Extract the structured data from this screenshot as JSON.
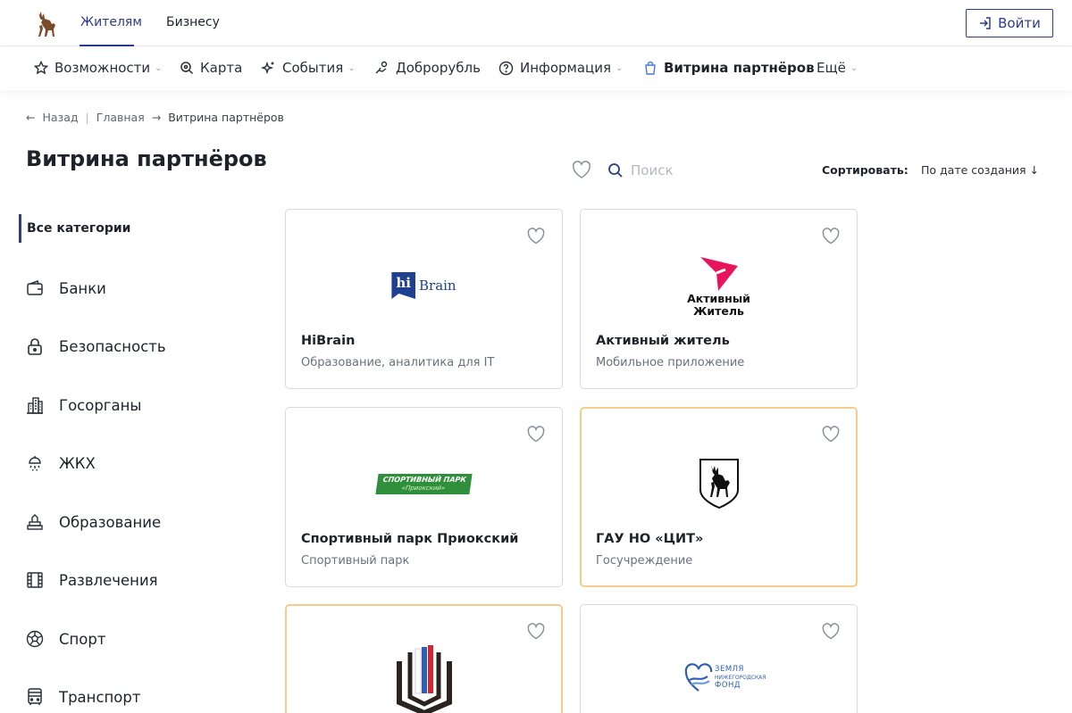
{
  "header": {
    "tabs": [
      {
        "label": "Жителям"
      },
      {
        "label": "Бизнесу"
      }
    ],
    "login_label": "Войти"
  },
  "nav": {
    "items": [
      {
        "label": "Возможности",
        "icon": "star-icon"
      },
      {
        "label": "Карта",
        "icon": "map-search-icon"
      },
      {
        "label": "События",
        "icon": "sparkle-icon"
      },
      {
        "label": "Доброрубль",
        "icon": "hand-coin-icon"
      },
      {
        "label": "Информация",
        "icon": "question-circle-icon"
      },
      {
        "label": "Витрина партнёров",
        "icon": "shopping-bag-icon"
      },
      {
        "label": "Ещё"
      }
    ]
  },
  "breadcrumb": {
    "back": "Назад",
    "home": "Главная",
    "current": "Витрина партнёров"
  },
  "page": {
    "title": "Витрина партнёров",
    "search_placeholder": "Поиск",
    "sort_label": "Сортировать:",
    "sort_value": "По дате создания"
  },
  "sidebar": {
    "all_label": "Все категории",
    "categories": [
      {
        "label": "Банки",
        "icon": "wallet-icon"
      },
      {
        "label": "Безопасность",
        "icon": "lock-icon"
      },
      {
        "label": "Госорганы",
        "icon": "building-icon"
      },
      {
        "label": "ЖКХ",
        "icon": "shower-icon"
      },
      {
        "label": "Образование",
        "icon": "books-icon"
      },
      {
        "label": "Развлечения",
        "icon": "film-icon"
      },
      {
        "label": "Спорт",
        "icon": "ball-icon"
      },
      {
        "label": "Транспорт",
        "icon": "bus-icon"
      }
    ]
  },
  "cards": [
    {
      "title": "HiBrain",
      "subtitle": "Образование, аналитика для IT",
      "logo_text": [
        "hi",
        "Brain"
      ]
    },
    {
      "title": "Активный житель",
      "subtitle": "Мобильное приложение",
      "logo_text": [
        "Активный",
        "Житель"
      ]
    },
    {
      "title": "Спортивный парк Приокский",
      "subtitle": "Спортивный парк",
      "logo_text": [
        "СПОРТИВНЫЙ ПАРК",
        "«Приокский»"
      ]
    },
    {
      "title": "ГАУ НО «ЦИТ»",
      "subtitle": "Госучреждение"
    },
    {
      "title": "",
      "subtitle": ""
    },
    {
      "title": "",
      "subtitle": "",
      "logo_text": [
        "ЗЕМЛЯ",
        "НИЖЕГОРОДСКАЯ",
        "ФОНД"
      ]
    }
  ],
  "colors": {
    "accent": "#2d3b8e",
    "highlight_border": "#f7cc8a",
    "active_zhitel_pink": "#e8155d",
    "sport_park_green": "#2f8f3a"
  }
}
